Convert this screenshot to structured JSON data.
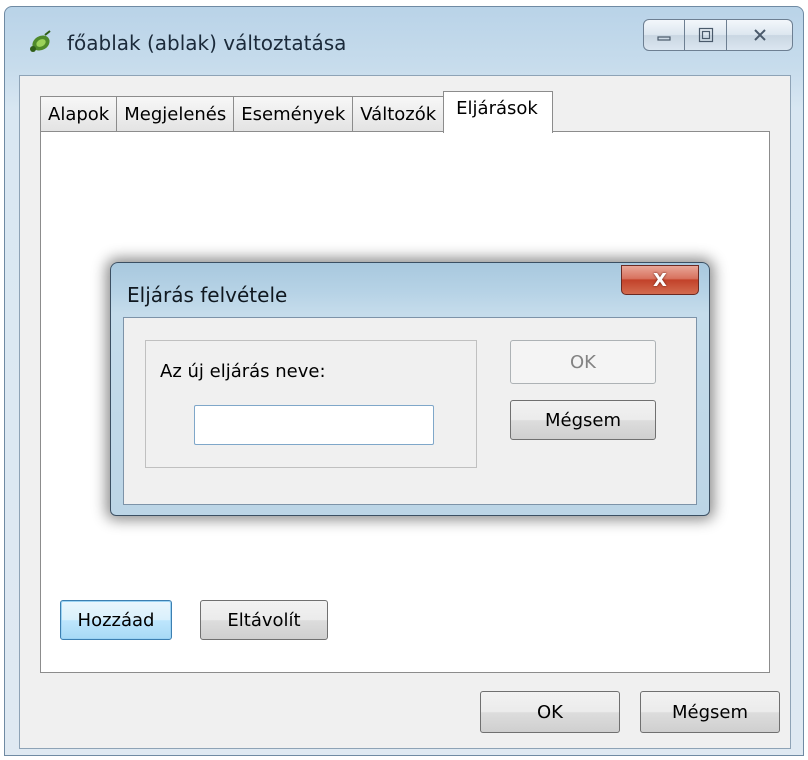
{
  "window": {
    "title": "főablak (ablak) változtatása",
    "caption": {
      "minimize": "–",
      "maximize": "▫",
      "close": "✕"
    }
  },
  "tabs": [
    {
      "label": "Alapok",
      "active": false
    },
    {
      "label": "Megjelenés",
      "active": false
    },
    {
      "label": "Események",
      "active": false
    },
    {
      "label": "Változók",
      "active": false
    },
    {
      "label": "Eljárások",
      "active": true
    }
  ],
  "panel": {
    "add_label": "Hozzáad",
    "remove_label": "Eltávolít"
  },
  "footer": {
    "ok_label": "OK",
    "cancel_label": "Mégsem"
  },
  "modal": {
    "title": "Eljárás felvétele",
    "close_glyph": "X",
    "name_label": "Az új eljárás neve:",
    "name_value": "",
    "ok_label": "OK",
    "ok_enabled": false,
    "cancel_label": "Mégsem"
  },
  "colors": {
    "window_frame": "#c7dcec",
    "client_bg": "#f0f0f0",
    "close_red": "#c2422a",
    "focus_blue": "#3c7fb1"
  }
}
